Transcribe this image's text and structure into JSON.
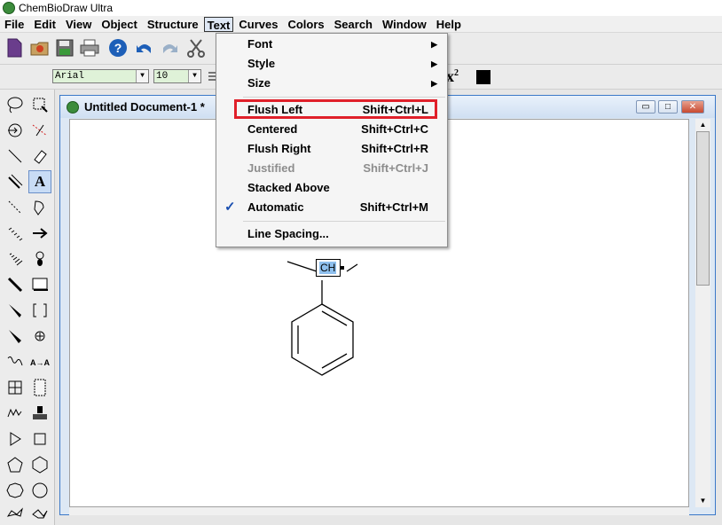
{
  "app": {
    "title": "ChemBioDraw Ultra",
    "icon": "chemdraw-logo-icon"
  },
  "menubar": {
    "items": [
      "File",
      "Edit",
      "View",
      "Object",
      "Structure",
      "Text",
      "Curves",
      "Colors",
      "Search",
      "Window",
      "Help"
    ],
    "active": "Text"
  },
  "toolbar": {
    "icons": [
      "new-document-icon",
      "open-icon",
      "save-icon",
      "print-icon",
      "help-icon",
      "undo-icon",
      "redo-icon",
      "cut-icon"
    ]
  },
  "formatbar": {
    "font_value": "Arial",
    "size_value": "10",
    "superscript_label": "x",
    "superscript_mark": "2",
    "color_hex": "#000000"
  },
  "document": {
    "title": "Untitled Document-1 *",
    "structure": {
      "label": "CH",
      "description_shape": "benzene-ring-with-substituent"
    }
  },
  "text_menu": {
    "items": [
      {
        "label": "Font",
        "shortcut": "",
        "submenu": true
      },
      {
        "label": "Style",
        "shortcut": "",
        "submenu": true
      },
      {
        "label": "Size",
        "shortcut": "",
        "submenu": true
      },
      {
        "label": "Flush Left",
        "shortcut": "Shift+Ctrl+L",
        "highlighted": true
      },
      {
        "label": "Centered",
        "shortcut": "Shift+Ctrl+C"
      },
      {
        "label": "Flush Right",
        "shortcut": "Shift+Ctrl+R"
      },
      {
        "label": "Justified",
        "shortcut": "Shift+Ctrl+J",
        "disabled": true
      },
      {
        "label": "Stacked Above",
        "shortcut": ""
      },
      {
        "label": "Automatic",
        "shortcut": "Shift+Ctrl+M",
        "checked": true
      },
      {
        "label": "Line Spacing...",
        "shortcut": ""
      }
    ]
  },
  "colors": {
    "highlight_border": "#e0202a",
    "selection_blue": "#3a78c8"
  }
}
